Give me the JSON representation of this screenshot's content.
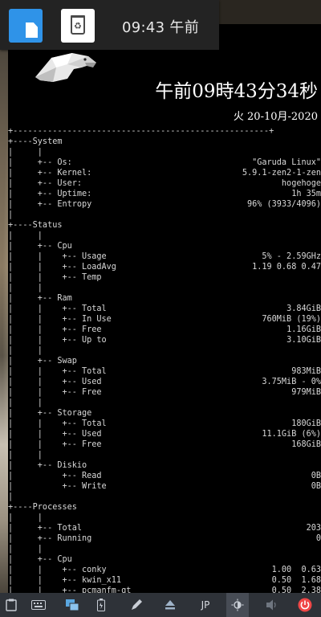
{
  "taskbar": {
    "clock": "09:43 午前",
    "apps": [
      {
        "name": "files",
        "icon": "file-manager-icon"
      },
      {
        "name": "trash",
        "icon": "trash-icon"
      }
    ]
  },
  "conky": {
    "big_time": "午前09時43分34秒",
    "date": "火 20-10月-2020",
    "lines": [
      {
        "t": "+----------------------------------------------------+",
        "v": ""
      },
      {
        "t": "+----System",
        "v": ""
      },
      {
        "t": "|     |",
        "v": ""
      },
      {
        "t": "|     +-- Os:",
        "v": "\"Garuda Linux\""
      },
      {
        "t": "|     +-- Kernel:",
        "v": "5.9.1-zen2-1-zen"
      },
      {
        "t": "|     +-- User:",
        "v": "hogehoge"
      },
      {
        "t": "|     +-- Uptime:",
        "v": "1h 35m"
      },
      {
        "t": "|     +-- Entropy",
        "v": "96% (3933/4096)"
      },
      {
        "t": "|",
        "v": ""
      },
      {
        "t": "+----Status",
        "v": ""
      },
      {
        "t": "|     |",
        "v": ""
      },
      {
        "t": "|     +-- Cpu",
        "v": ""
      },
      {
        "t": "|     |    +-- Usage",
        "v": "5% - 2.59GHz"
      },
      {
        "t": "|     |    +-- LoadAvg",
        "v": "1.19 0.68 0.47"
      },
      {
        "t": "|     |    +-- Temp",
        "v": ""
      },
      {
        "t": "|     |",
        "v": ""
      },
      {
        "t": "|     +-- Ram",
        "v": ""
      },
      {
        "t": "|     |    +-- Total",
        "v": "3.84GiB"
      },
      {
        "t": "|     |    +-- In Use",
        "v": "760MiB (19%)"
      },
      {
        "t": "|     |    +-- Free",
        "v": "1.16GiB"
      },
      {
        "t": "|     |    +-- Up to",
        "v": "3.10GiB"
      },
      {
        "t": "|     |",
        "v": ""
      },
      {
        "t": "|     +-- Swap",
        "v": ""
      },
      {
        "t": "|     |    +-- Total",
        "v": "983MiB"
      },
      {
        "t": "|     |    +-- Used",
        "v": "3.75MiB - 0%"
      },
      {
        "t": "|     |    +-- Free",
        "v": "979MiB"
      },
      {
        "t": "|     |",
        "v": ""
      },
      {
        "t": "|     +-- Storage",
        "v": ""
      },
      {
        "t": "|     |    +-- Total",
        "v": "180GiB"
      },
      {
        "t": "|     |    +-- Used",
        "v": "11.1GiB (6%)"
      },
      {
        "t": "|     |    +-- Free",
        "v": "168GiB"
      },
      {
        "t": "|     |",
        "v": ""
      },
      {
        "t": "|     +-- Diskio",
        "v": ""
      },
      {
        "t": "|          +-- Read",
        "v": "0B"
      },
      {
        "t": "|          +-- Write",
        "v": "0B"
      },
      {
        "t": "|",
        "v": ""
      },
      {
        "t": "+----Processes",
        "v": ""
      },
      {
        "t": "|     |",
        "v": ""
      },
      {
        "t": "|     +-- Total",
        "v": "203"
      },
      {
        "t": "|     +-- Running",
        "v": "0"
      },
      {
        "t": "|     |",
        "v": ""
      },
      {
        "t": "|     +-- Cpu",
        "v": ""
      },
      {
        "t": "|     |    +-- conky",
        "v": "1.00  0.63"
      },
      {
        "t": "|     |    +-- kwin_x11",
        "v": "0.50  1.68"
      },
      {
        "t": "|     |    +-- pcmanfm-qt",
        "v": "0.50  2.38"
      }
    ]
  },
  "bottombar": {
    "layout_label": "JP",
    "tray": [
      "clipboard-icon",
      "keyboard-icon",
      "windows-icon",
      "battery-icon",
      "pen-icon",
      "eject-icon",
      "layout-indicator",
      "brightness-icon",
      "volume-icon",
      "power-icon"
    ]
  },
  "colors": {
    "panel_bg": "#000000",
    "text": "#d8d8d8",
    "taskbar": "#232323",
    "bottombar": "#2e3238",
    "power": "#f04747",
    "files_app": "#2f93e8"
  }
}
